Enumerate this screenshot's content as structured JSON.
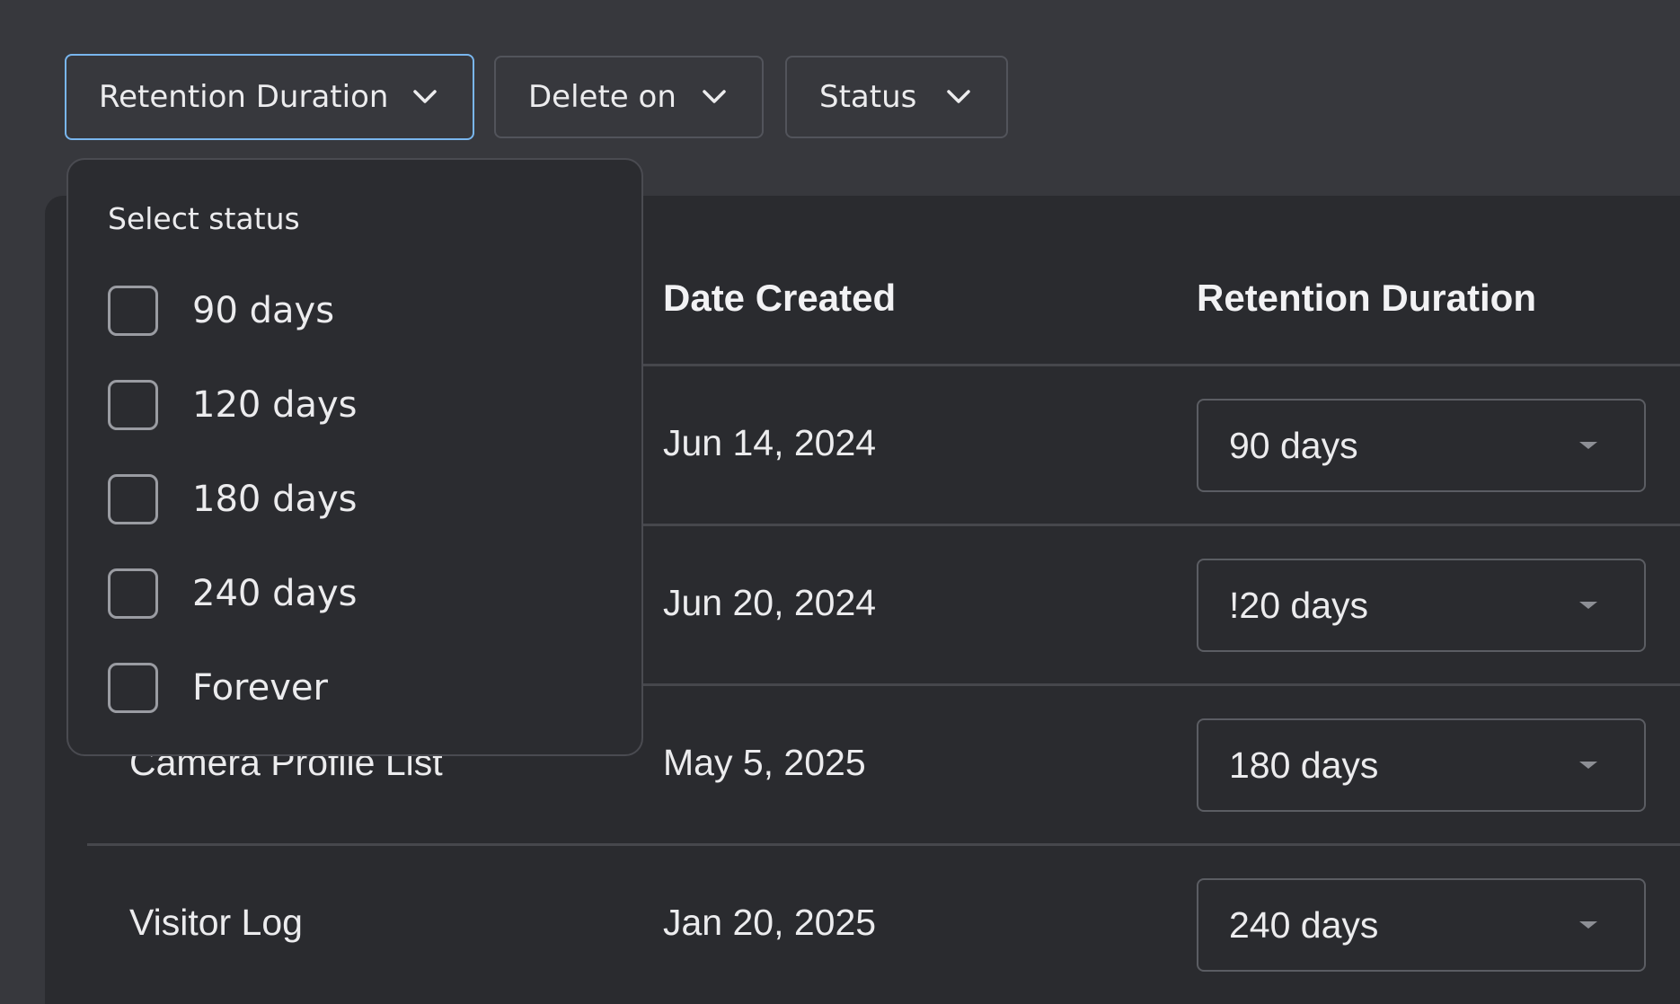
{
  "filters": {
    "retention": {
      "label": "Retention Duration"
    },
    "delete_on": {
      "label": "Delete on"
    },
    "status": {
      "label": "Status"
    }
  },
  "dropdown": {
    "title": "Select status",
    "options": [
      {
        "label": "90 days",
        "checked": false
      },
      {
        "label": "120 days",
        "checked": false
      },
      {
        "label": "180 days",
        "checked": false
      },
      {
        "label": "240 days",
        "checked": false
      },
      {
        "label": "Forever",
        "checked": false
      }
    ]
  },
  "table": {
    "headers": {
      "date_created": "Date Created",
      "retention_duration": "Retention Duration"
    },
    "rows": [
      {
        "name": "",
        "date": "Jun 14, 2024",
        "retention": "90 days"
      },
      {
        "name": "",
        "date": "Jun 20, 2024",
        "retention": "!20 days"
      },
      {
        "name": "Camera Profile List",
        "date": "May 5, 2025",
        "retention": "180 days"
      },
      {
        "name": "Visitor Log",
        "date": "Jan 20, 2025",
        "retention": "240 days"
      }
    ]
  },
  "colors": {
    "page_bg": "#37383d",
    "card_bg": "#2a2b2f",
    "active_border": "#79b6ee"
  },
  "icons": {
    "filter_chevron": "chevron-down-icon",
    "select_caret": "caret-down-icon"
  }
}
